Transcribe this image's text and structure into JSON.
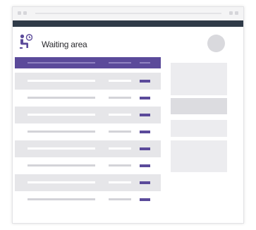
{
  "header": {
    "title": "Waiting area",
    "icon": "seated-person-clock-icon"
  },
  "colors": {
    "accent": "#5b4a9a",
    "topbar": "#2f3a48",
    "placeholder": "#d9d9dd"
  },
  "table": {
    "columns": 3,
    "rows": 8,
    "shaded_rows": [
      0,
      2,
      4,
      6
    ]
  }
}
